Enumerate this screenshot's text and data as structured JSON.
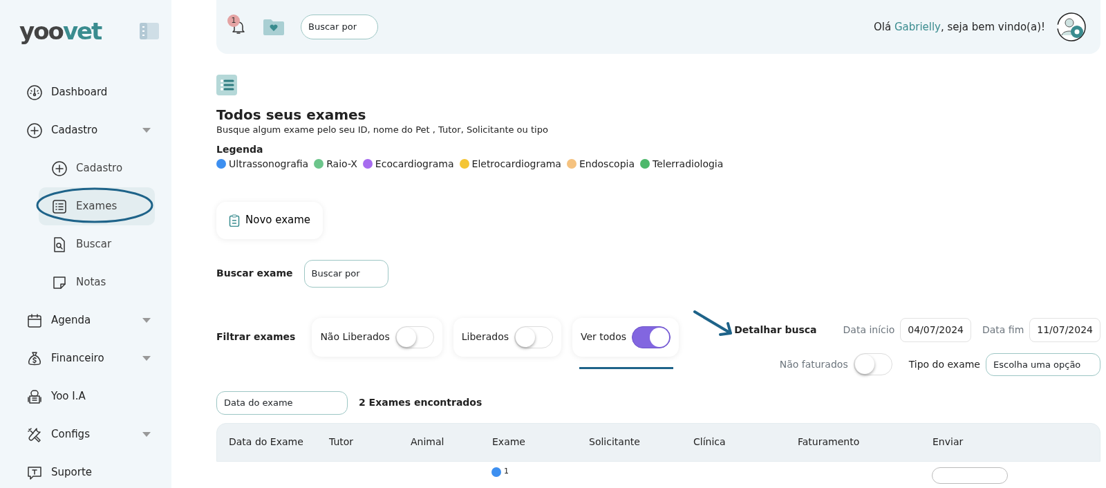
{
  "sidebar": {
    "logo": {
      "part_1": "yoo",
      "part_2": "vet"
    },
    "items": [
      {
        "label": "Dashboard",
        "selected": false,
        "has_menu": false
      },
      {
        "label": "Cadastro",
        "selected": false,
        "has_menu": true,
        "children": [
          {
            "label": "Cadastro",
            "selected": false
          },
          {
            "label": "Exames",
            "selected": true
          },
          {
            "label": "Buscar",
            "selected": false
          },
          {
            "label": "Notas",
            "selected": false
          }
        ]
      },
      {
        "label": "Agenda",
        "selected": false,
        "has_menu": true
      },
      {
        "label": "Financeiro",
        "selected": false,
        "has_menu": true
      },
      {
        "label": "Yoo I.A",
        "selected": false,
        "has_menu": false
      },
      {
        "label": "Configs",
        "selected": false,
        "has_menu": true
      },
      {
        "label": "Suporte",
        "selected": false,
        "has_menu": false
      }
    ]
  },
  "topbar": {
    "notification_count": "1",
    "search_select": {
      "placeholder": "Buscar por"
    },
    "greeting": "Olá **Gabrielly**, seja bem vindo(a)!"
  },
  "page": {
    "title": "Todos seus exames",
    "subtitle": "Busque algum exame pelo seu ID, nome do Pet , Tutor, Solicitante ou tipo",
    "legend_title": "Legenda",
    "legend": [
      {
        "label": "Ultrassonografia",
        "color": "#3d8ff0"
      },
      {
        "label": "Raio-X",
        "color": "#6cc58b"
      },
      {
        "label": "Ecocardiograma",
        "color": "#a76cef"
      },
      {
        "label": "Eletrocardiograma",
        "color": "#f4c534"
      },
      {
        "label": "Endoscopia",
        "color": "#f5c27f"
      },
      {
        "label": "Telerradiologia",
        "color": "#4db86b"
      }
    ],
    "new_button": "Novo exame",
    "search": {
      "label": "Buscar exame",
      "placeholder": "Buscar por"
    },
    "filters": {
      "label": "Filtrar exames",
      "toggles": [
        {
          "label": "Não Liberados",
          "on": false
        },
        {
          "label": "Liberados",
          "on": false
        },
        {
          "label": "Ver todos",
          "on": true
        }
      ]
    },
    "details": {
      "label": "Detalhar busca",
      "start_label": "Data início",
      "start": "04/07/2024",
      "end_label": "Data fim",
      "end": "11/07/2024",
      "unbilled": {
        "label": "Não faturados",
        "on": false
      },
      "type_label": "Tipo do exame",
      "type_placeholder": "Escolha uma opção"
    },
    "sort_select": "Data do exame",
    "result_count": "2 Exames encontrados",
    "table": {
      "columns": [
        "Data do Exame",
        "Tutor",
        "Animal",
        "Exame",
        "Solicitante",
        "Clínica",
        "Faturamento",
        "Enviar"
      ],
      "rows": [
        {
          "color": "#3d8ff0",
          "exam": "1"
        }
      ]
    }
  }
}
